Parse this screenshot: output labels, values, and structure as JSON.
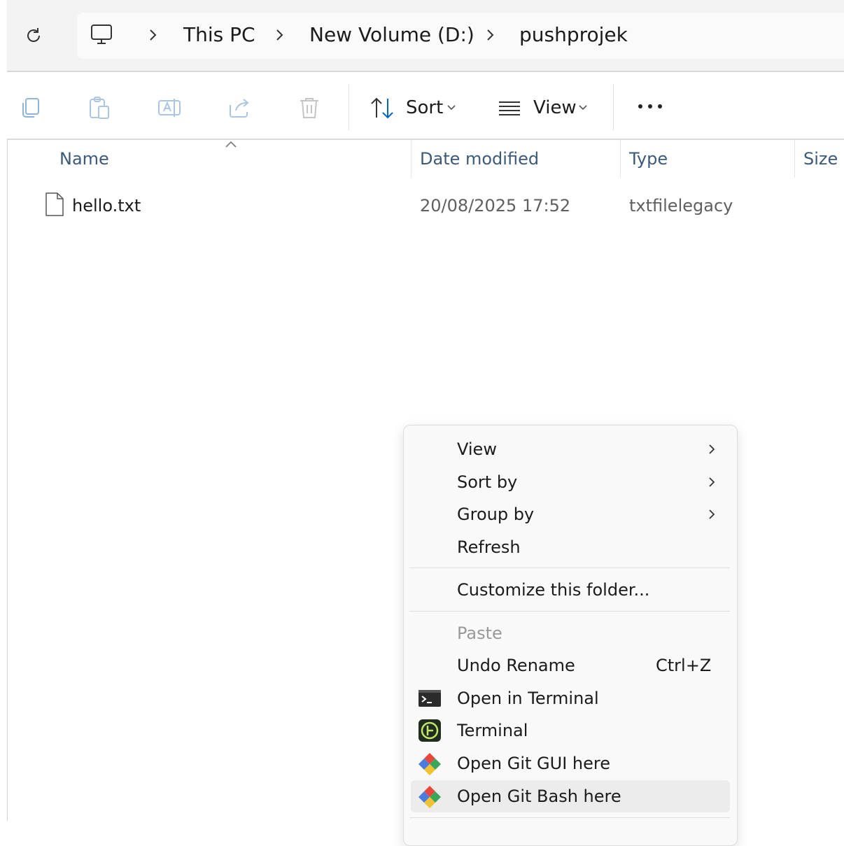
{
  "breadcrumb": {
    "items": [
      "This PC",
      "New Volume (D:)",
      "pushprojek"
    ]
  },
  "toolbar": {
    "sort_label": "Sort",
    "view_label": "View"
  },
  "columns": {
    "name": "Name",
    "date_modified": "Date modified",
    "type": "Type",
    "size": "Size"
  },
  "files": [
    {
      "name": "hello.txt",
      "date_modified": "20/08/2025 17:52",
      "type": "txtfilelegacy",
      "size": ""
    }
  ],
  "context_menu": {
    "items": [
      {
        "label": "View",
        "submenu": true
      },
      {
        "label": "Sort by",
        "submenu": true
      },
      {
        "label": "Group by",
        "submenu": true
      },
      {
        "label": "Refresh"
      },
      {
        "label": "Customize this folder..."
      },
      {
        "label": "Paste",
        "disabled": true
      },
      {
        "label": "Undo Rename",
        "shortcut": "Ctrl+Z"
      },
      {
        "label": "Open in Terminal",
        "icon": "terminal-icon"
      },
      {
        "label": "Terminal",
        "icon": "terminal-app-icon"
      },
      {
        "label": "Open Git GUI here",
        "icon": "git-icon"
      },
      {
        "label": "Open Git Bash here",
        "icon": "git-icon",
        "highlighted": true
      }
    ]
  },
  "colors": {
    "accent": "#0067c0",
    "header_text": "#3b5a7a",
    "menu_background": "#f9f9f9",
    "git_red": "#e8453c",
    "git_blue": "#4a7be0",
    "git_yellow": "#f1c232",
    "git_green": "#3aa757"
  }
}
